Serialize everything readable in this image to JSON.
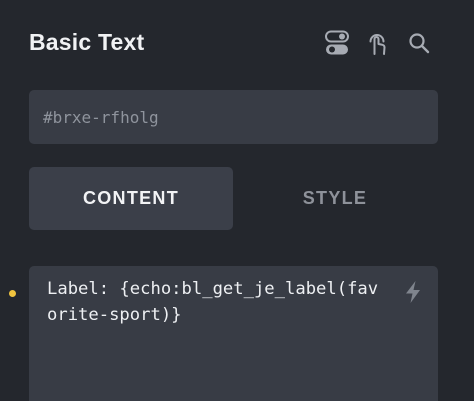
{
  "header": {
    "title": "Basic Text",
    "icons": [
      "toggle-icon",
      "touch-icon",
      "search-icon"
    ]
  },
  "element_id": {
    "value": "#brxe-rfholg"
  },
  "tabs": [
    {
      "label": "CONTENT",
      "active": true
    },
    {
      "label": "STYLE",
      "active": false
    }
  ],
  "text_control": {
    "value": "Label: {echo:bl_get_je_label(favorite-sport)}",
    "indicator_color": "#f0c43f",
    "dynamic_data_icon": "bolt-icon"
  },
  "colors": {
    "background": "#24272d",
    "field": "#383c45",
    "tab_active": "#3b3f49",
    "accent": "#f0c43f"
  }
}
